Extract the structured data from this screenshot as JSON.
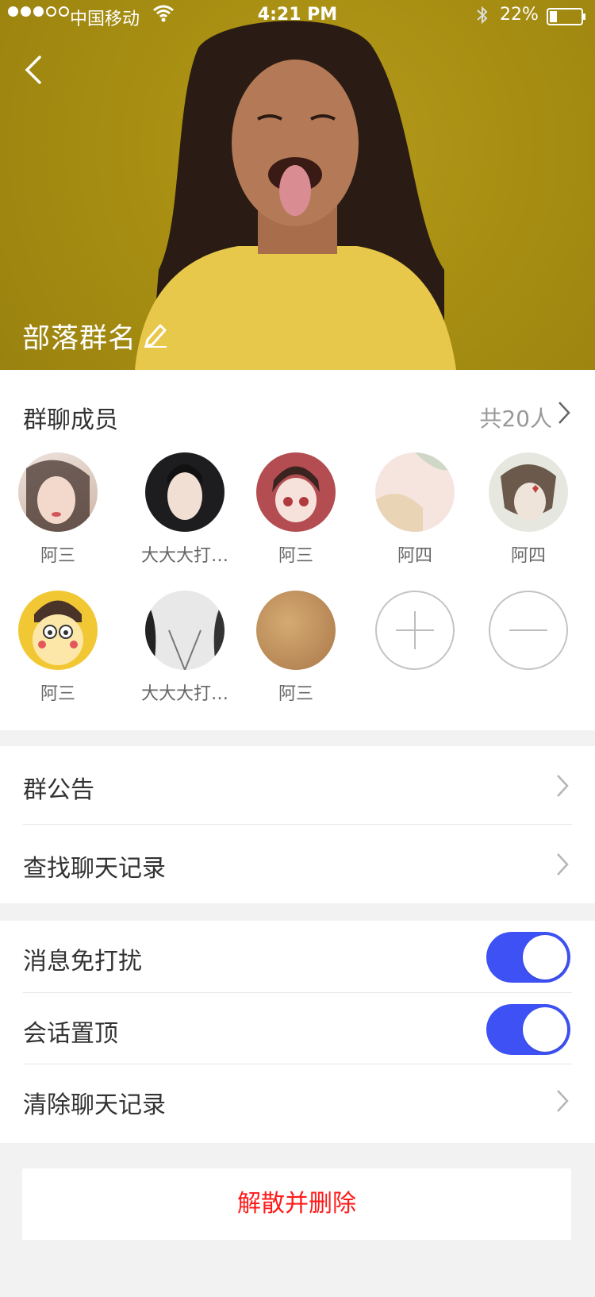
{
  "status_bar": {
    "carrier": "中国移动",
    "time": "4:21 PM",
    "battery": "22%",
    "signal_dots_on": 3,
    "signal_dots_total": 5
  },
  "header": {
    "group_name": "部落群名",
    "background_color": "#a88f12"
  },
  "members": {
    "title": "群聊成员",
    "count_label": "共20人",
    "items": [
      {
        "name": "阿三",
        "avatar_color": "#e8d9cf"
      },
      {
        "name": "大大大打…",
        "avatar_color": "#2a2a2a"
      },
      {
        "name": "阿三",
        "avatar_color": "#b5565a"
      },
      {
        "name": "阿四",
        "avatar_color": "#f4dcd7"
      },
      {
        "name": "阿四",
        "avatar_color": "#d9dcd0"
      },
      {
        "name": "阿三",
        "avatar_color": "#f3c93a"
      },
      {
        "name": "大大大打…",
        "avatar_color": "#d8d8d8"
      },
      {
        "name": "阿三",
        "avatar_color": "#c79a5e"
      }
    ]
  },
  "menu_group1": {
    "items": [
      {
        "label": "群公告"
      },
      {
        "label": "查找聊天记录"
      }
    ]
  },
  "menu_group2": {
    "items": [
      {
        "label": "消息免打扰",
        "toggle_on": true
      },
      {
        "label": "会话置顶",
        "toggle_on": true
      },
      {
        "label": "清除聊天记录"
      }
    ]
  },
  "dissolve_button": {
    "label": "解散并删除",
    "color": "#ff1a1a"
  },
  "accent_color": "#3d51f4"
}
